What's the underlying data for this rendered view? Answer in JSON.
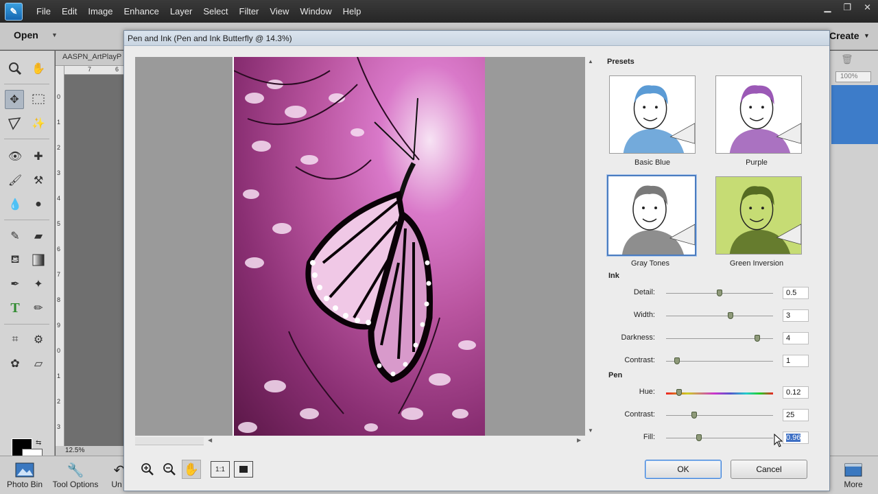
{
  "menu": [
    "File",
    "Edit",
    "Image",
    "Enhance",
    "Layer",
    "Select",
    "Filter",
    "View",
    "Window",
    "Help"
  ],
  "modebar": {
    "open": "Open",
    "create": "Create"
  },
  "document": {
    "tab_title": "AASPN_ArtPlayP",
    "zoom": "12.5%",
    "ruler_top": [
      "7",
      "6"
    ],
    "ruler_left": [
      "0",
      "1",
      "2",
      "3",
      "4",
      "5",
      "6",
      "7",
      "8",
      "9",
      "0",
      "1",
      "2",
      "3"
    ]
  },
  "right_panel": {
    "zoom": "100%"
  },
  "bottom_bar": {
    "photo_bin": "Photo Bin",
    "tool_options": "Tool Options",
    "undo_partial": "Un",
    "more": "More"
  },
  "dialog": {
    "title": "Pen and Ink (Pen and Ink Butterfly @ 14.3%)",
    "presets_title": "Presets",
    "presets": [
      {
        "label": "Basic Blue",
        "tint": "#5b9bd5",
        "selected": false
      },
      {
        "label": "Purple",
        "tint": "#9b59b6",
        "selected": false
      },
      {
        "label": "Gray Tones",
        "tint": "#7a7a7a",
        "selected": true
      },
      {
        "label": "Green Inversion",
        "tint": "#c6dc74",
        "selected": false
      }
    ],
    "ink_title": "Ink",
    "ink": [
      {
        "label": "Detail:",
        "value": "0.5",
        "level": 0.5
      },
      {
        "label": "Width:",
        "value": "3",
        "level": 0.6
      },
      {
        "label": "Darkness:",
        "value": "4",
        "level": 0.85
      },
      {
        "label": "Contrast:",
        "value": "1",
        "level": 0.1
      }
    ],
    "pen_title": "Pen",
    "pen": [
      {
        "label": "Hue:",
        "value": "0.12",
        "level": 0.12
      },
      {
        "label": "Contrast:",
        "value": "25",
        "level": 0.26
      },
      {
        "label": "Fill:",
        "value": "0.96",
        "level": 0.31
      }
    ],
    "ok": "OK",
    "cancel": "Cancel",
    "one_to_one": "1:1"
  },
  "colors": {
    "accent": "#3d7cc9",
    "photo_pink": "#d979c9"
  }
}
